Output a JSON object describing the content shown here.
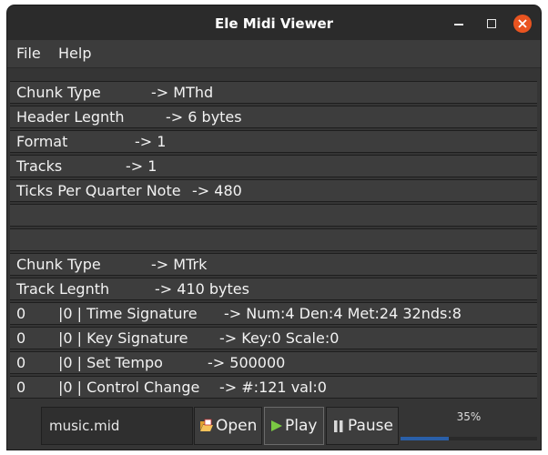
{
  "window": {
    "title": "Ele Midi Viewer"
  },
  "menu": {
    "file": "File",
    "help": "Help"
  },
  "rows": [
    {
      "col1": "Chunk Type",
      "col2": "-> MThd"
    },
    {
      "col1": "Header Legnth",
      "col2": "-> 6 bytes"
    },
    {
      "col1": "Format",
      "col2": "-> 1"
    },
    {
      "col1": "Tracks",
      "col2": "-> 1"
    },
    {
      "col1": "Ticks Per Quarter Note",
      "col2": "-> 480"
    },
    {
      "col1": "",
      "col2": ""
    },
    {
      "col1": "",
      "col2": ""
    },
    {
      "col1": "Chunk Type",
      "col2": "-> MTrk"
    },
    {
      "col1": "Track Legnth",
      "col2": "-> 410 bytes"
    },
    {
      "col1": "0",
      "col2": "|0 | Time Signature",
      "col3": "-> Num:4 Den:4 Met:24 32nds:8"
    },
    {
      "col1": "0",
      "col2": "|0 | Key Signature",
      "col3": "-> Key:0 Scale:0"
    },
    {
      "col1": "0",
      "col2": "|0 | Set Tempo",
      "col3": "-> 500000"
    },
    {
      "col1": "0",
      "col2": "|0 | Control Change",
      "col3": "-> #:121 val:0"
    }
  ],
  "player": {
    "filename": "music.mid",
    "open_label": "Open",
    "play_label": "Play",
    "pause_label": "Pause",
    "progress_text": "35%",
    "progress_fraction": 0.35
  },
  "colors": {
    "close_button": "#e95420",
    "play_icon": "#7ac943",
    "progress_fill": "#2a5fa8"
  }
}
